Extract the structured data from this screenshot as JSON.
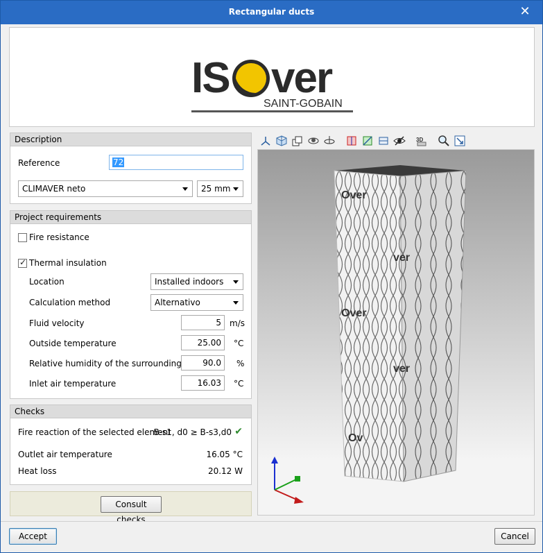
{
  "window": {
    "title": "Rectangular ducts"
  },
  "logo": {
    "brand": "ISOVER",
    "sub": "SAINT-GOBAIN"
  },
  "description": {
    "header": "Description",
    "reference_label": "Reference",
    "reference_value": "72",
    "product": "CLIMAVER neto",
    "thickness": "25 mm"
  },
  "requirements": {
    "header": "Project requirements",
    "fire_resistance": "Fire resistance",
    "thermal_insulation": "Thermal insulation",
    "location_label": "Location",
    "location_value": "Installed indoors",
    "calc_label": "Calculation method",
    "calc_value": "Alternativo",
    "velocity_label": "Fluid velocity",
    "velocity_value": "5",
    "velocity_unit": "m/s",
    "outside_temp_label": "Outside temperature",
    "outside_temp_value": "25.00",
    "outside_temp_unit": "°C",
    "humidity_label": "Relative humidity of the surroundings",
    "humidity_value": "90.0",
    "humidity_unit": "%",
    "inlet_temp_label": "Inlet air temperature",
    "inlet_temp_value": "16.03",
    "inlet_temp_unit": "°C"
  },
  "checks": {
    "header": "Checks",
    "fire_reaction_label": "Fire reaction of the selected element",
    "fire_reaction_value": "B-s1, d0 ≥ B-s3,d0",
    "outlet_label": "Outlet air temperature",
    "outlet_value": "16.05 °C",
    "heat_loss_label": "Heat loss",
    "heat_loss_value": "20.12 W",
    "consult_button": "Consult checks"
  },
  "buttons": {
    "accept": "Accept",
    "cancel": "Cancel"
  },
  "colors": {
    "titlebar": "#2a6cc4",
    "check_ok": "#2e8b2e",
    "brand_yellow": "#f2c500"
  }
}
